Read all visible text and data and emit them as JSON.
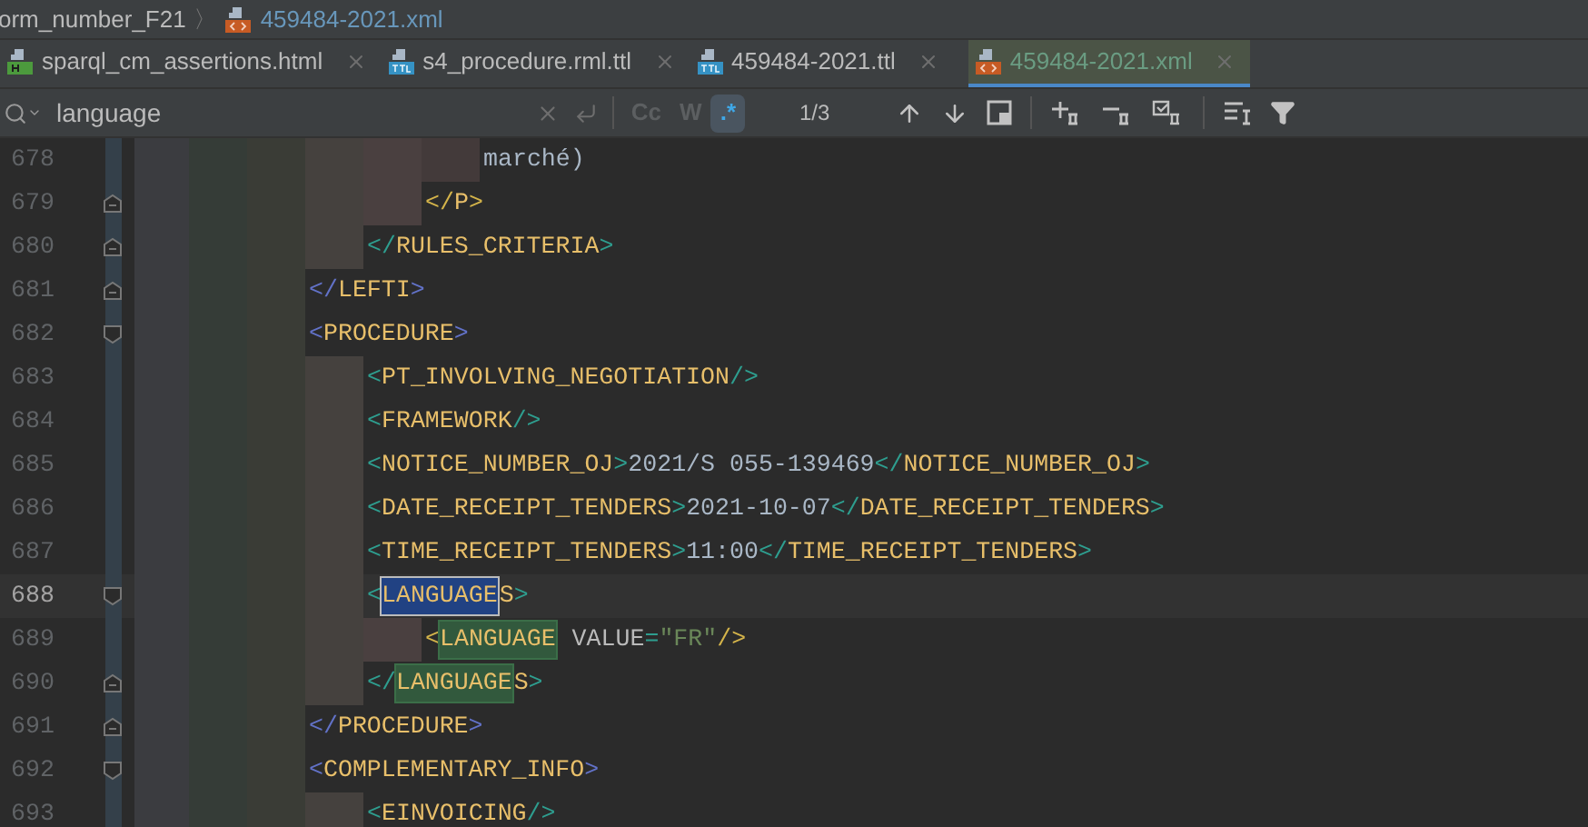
{
  "breadcrumb": {
    "items": [
      {
        "label": "orm_number_F21",
        "kind": "folder"
      },
      {
        "label": "459484-2021.xml",
        "kind": "xml"
      }
    ],
    "separator": "〉"
  },
  "tabs": [
    {
      "label": "sparql_cm_assertions.html",
      "kind": "html",
      "selected": false
    },
    {
      "label": "s4_procedure.rml.ttl",
      "kind": "ttl",
      "selected": false
    },
    {
      "label": "459484-2021.ttl",
      "kind": "ttl",
      "selected": false
    },
    {
      "label": "459484-2021.xml",
      "kind": "xml",
      "selected": true
    }
  ],
  "search": {
    "value": "language",
    "options": [
      {
        "label": "Cc",
        "selected": false
      },
      {
        "label": "W",
        "selected": false
      },
      {
        "label": ".*",
        "selected": true
      }
    ],
    "count": "1/3"
  },
  "lines": [
    {
      "children": [
        {
          "children": [
            {
              "children": [
                {
                  "number": "678",
                  "fold_start": false,
                  "fold_end": false,
                  "current": false,
                  "tokens": [
                    {
                      "kind": "text",
                      "text": "marché)"
                    }
                  ]
                }
              ]
            },
            {
              "number": "679",
              "fold_start": false,
              "fold_end": true,
              "current": false,
              "tokens": [
                {
                  "kind": "bracket",
                  "text": "</",
                  "color": "#d4b44a"
                },
                {
                  "kind": "tag",
                  "text": "P"
                },
                {
                  "kind": "bracket",
                  "text": ">",
                  "color": "#d4b44a"
                }
              ]
            }
          ]
        },
        {
          "number": "680",
          "fold_start": false,
          "fold_end": true,
          "current": false,
          "tokens": [
            {
              "kind": "bracket",
              "text": "</",
              "color": "#2e9e8f"
            },
            {
              "kind": "tag",
              "text": "RULES_CRITERIA"
            },
            {
              "kind": "bracket",
              "text": ">",
              "color": "#2e9e8f"
            }
          ]
        }
      ]
    },
    {
      "number": "681",
      "fold_start": false,
      "fold_end": true,
      "current": false,
      "tokens": [
        {
          "kind": "bracket",
          "text": "</",
          "color": "#6272c8"
        },
        {
          "kind": "tag",
          "text": "LEFTI"
        },
        {
          "kind": "bracket",
          "text": ">",
          "color": "#6272c8"
        }
      ]
    },
    {
      "number": "682",
      "fold_start": true,
      "fold_end": false,
      "current": false,
      "tokens": [
        {
          "kind": "bracket",
          "text": "<",
          "color": "#6272c8"
        },
        {
          "kind": "tag",
          "text": "PROCEDURE"
        },
        {
          "kind": "bracket",
          "text": ">",
          "color": "#6272c8"
        }
      ],
      "children": [
        {
          "number": "683",
          "fold_start": false,
          "fold_end": false,
          "current": false,
          "tokens": [
            {
              "kind": "bracket",
              "text": "<",
              "color": "#2e9e8f"
            },
            {
              "kind": "tag",
              "text": "PT_INVOLVING_NEGOTIATION"
            },
            {
              "kind": "bracket",
              "text": "/>",
              "color": "#2e9e8f"
            }
          ]
        },
        {
          "number": "684",
          "fold_start": false,
          "fold_end": false,
          "current": false,
          "tokens": [
            {
              "kind": "bracket",
              "text": "<",
              "color": "#2e9e8f"
            },
            {
              "kind": "tag",
              "text": "FRAMEWORK"
            },
            {
              "kind": "bracket",
              "text": "/>",
              "color": "#2e9e8f"
            }
          ]
        },
        {
          "number": "685",
          "fold_start": false,
          "fold_end": false,
          "current": false,
          "tokens": [
            {
              "kind": "bracket",
              "text": "<",
              "color": "#2e9e8f"
            },
            {
              "kind": "tag",
              "text": "NOTICE_NUMBER_OJ"
            },
            {
              "kind": "bracket",
              "text": ">",
              "color": "#2e9e8f"
            },
            {
              "kind": "text",
              "text": "2021/S 055-139469"
            },
            {
              "kind": "bracket",
              "text": "</",
              "color": "#2e9e8f"
            },
            {
              "kind": "tag",
              "text": "NOTICE_NUMBER_OJ"
            },
            {
              "kind": "bracket",
              "text": ">",
              "color": "#2e9e8f"
            }
          ]
        },
        {
          "number": "686",
          "fold_start": false,
          "fold_end": false,
          "current": false,
          "tokens": [
            {
              "kind": "bracket",
              "text": "<",
              "color": "#2e9e8f"
            },
            {
              "kind": "tag",
              "text": "DATE_RECEIPT_TENDERS"
            },
            {
              "kind": "bracket",
              "text": ">",
              "color": "#2e9e8f"
            },
            {
              "kind": "text",
              "text": "2021-10-07"
            },
            {
              "kind": "bracket",
              "text": "</",
              "color": "#2e9e8f"
            },
            {
              "kind": "tag",
              "text": "DATE_RECEIPT_TENDERS"
            },
            {
              "kind": "bracket",
              "text": ">",
              "color": "#2e9e8f"
            }
          ]
        },
        {
          "number": "687",
          "fold_start": false,
          "fold_end": false,
          "current": false,
          "tokens": [
            {
              "kind": "bracket",
              "text": "<",
              "color": "#2e9e8f"
            },
            {
              "kind": "tag",
              "text": "TIME_RECEIPT_TENDERS"
            },
            {
              "kind": "bracket",
              "text": ">",
              "color": "#2e9e8f"
            },
            {
              "kind": "text",
              "text": "11:00"
            },
            {
              "kind": "bracket",
              "text": "</",
              "color": "#2e9e8f"
            },
            {
              "kind": "tag",
              "text": "TIME_RECEIPT_TENDERS"
            },
            {
              "kind": "bracket",
              "text": ">",
              "color": "#2e9e8f"
            }
          ]
        },
        {
          "number": "688",
          "fold_start": true,
          "fold_end": false,
          "current": true,
          "tokens": [
            {
              "kind": "bracket",
              "text": "<",
              "color": "#2e9e8f"
            },
            {
              "kind": "match-current",
              "text": "LANGUAGE"
            },
            {
              "kind": "tag",
              "text": "S"
            },
            {
              "kind": "bracket",
              "text": ">",
              "color": "#2e9e8f"
            }
          ],
          "children": [
            {
              "number": "689",
              "fold_start": false,
              "fold_end": false,
              "current": false,
              "tokens": [
                {
                  "kind": "bracket",
                  "text": "<",
                  "color": "#d4b44a"
                },
                {
                  "kind": "match",
                  "text": "LANGUAGE"
                },
                {
                  "kind": "attr",
                  "text": "VALUE"
                },
                {
                  "kind": "bracket",
                  "text": "=",
                  "color": "#2e9e8f"
                },
                {
                  "kind": "string",
                  "text": "\"FR\""
                },
                {
                  "kind": "bracket",
                  "text": "/>",
                  "color": "#d4b44a"
                }
              ]
            }
          ]
        },
        {
          "number": "690",
          "fold_start": false,
          "fold_end": true,
          "current": false,
          "tokens": [
            {
              "kind": "bracket",
              "text": "</",
              "color": "#2e9e8f"
            },
            {
              "kind": "match",
              "text": "LANGUAGE"
            },
            {
              "kind": "tag",
              "text": "S"
            },
            {
              "kind": "bracket",
              "text": ">",
              "color": "#2e9e8f"
            }
          ]
        }
      ]
    },
    {
      "number": "691",
      "fold_start": false,
      "fold_end": true,
      "current": false,
      "tokens": [
        {
          "kind": "bracket",
          "text": "</",
          "color": "#6272c8"
        },
        {
          "kind": "tag",
          "text": "PROCEDURE"
        },
        {
          "kind": "bracket",
          "text": ">",
          "color": "#6272c8"
        }
      ]
    },
    {
      "number": "692",
      "fold_start": true,
      "fold_end": false,
      "current": false,
      "tokens": [
        {
          "kind": "bracket",
          "text": "<",
          "color": "#6272c8"
        },
        {
          "kind": "tag",
          "text": "COMPLEMENTARY_INFO"
        },
        {
          "kind": "bracket",
          "text": ">",
          "color": "#6272c8"
        }
      ],
      "children": [
        {
          "number": "693",
          "fold_start": false,
          "fold_end": false,
          "current": false,
          "tokens": [
            {
              "kind": "bracket",
              "text": "<",
              "color": "#2e9e8f"
            },
            {
              "kind": "tag",
              "text": "EINVOICING"
            },
            {
              "kind": "bracket",
              "text": "/>",
              "color": "#2e9e8f"
            }
          ]
        }
      ]
    }
  ]
}
